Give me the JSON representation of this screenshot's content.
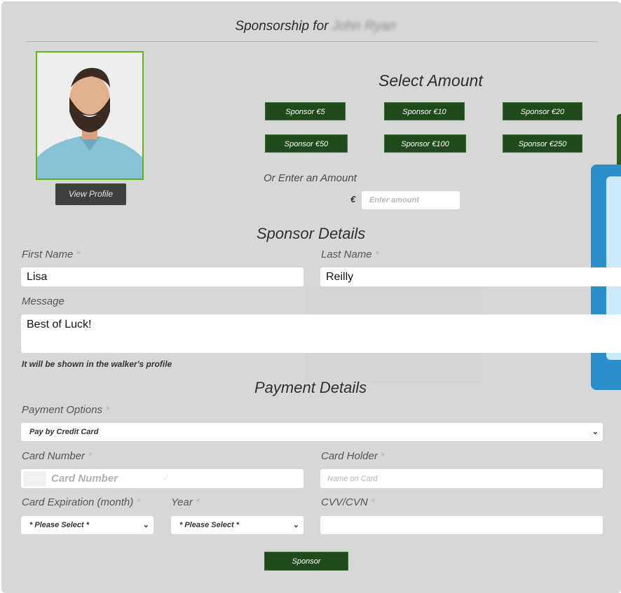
{
  "header": {
    "title_prefix": "Sponsorship for",
    "sponsoree_name": "John Ryan"
  },
  "profile": {
    "view_profile_label": "View Profile"
  },
  "amount": {
    "heading": "Select Amount",
    "buttons": [
      "Sponsor €5",
      "Sponsor €10",
      "Sponsor €20",
      "Sponsor €50",
      "Sponsor €100",
      "Sponsor €250"
    ],
    "custom_label": "Or Enter an Amount",
    "currency_symbol": "€",
    "custom_placeholder": "Enter amount"
  },
  "sponsor_details": {
    "heading": "Sponsor Details",
    "first_name_label": "First Name",
    "first_name_value": "Lisa",
    "last_name_label": "Last Name",
    "last_name_value": "Reilly",
    "message_label": "Message",
    "message_value": "Best of Luck!",
    "message_note": "It will be shown in the walker's profile",
    "required_mark": "*"
  },
  "payment_details": {
    "heading": "Payment Details",
    "options_label": "Payment Options",
    "options_selected": "Pay by Credit Card",
    "card_number_label": "Card Number",
    "card_number_placeholder": "Card Number",
    "card_holder_label": "Card Holder",
    "card_holder_placeholder": "Name on Card",
    "exp_month_label": "Card Expiration (month)",
    "exp_month_selected": "* Please Select *",
    "year_label": "Year",
    "year_selected": "* Please Select *",
    "cvv_label": "CVV/CVN",
    "required_mark": "*"
  },
  "submit": {
    "label": "Sponsor"
  },
  "colors": {
    "panel_bg": "#d7d7d7",
    "button_green": "#1f4a1b",
    "photo_border": "#62b218",
    "view_profile_bg": "#404040"
  },
  "icons": [
    "chevron-down-icon",
    "card-brand-icon",
    "checkmark-icon"
  ]
}
